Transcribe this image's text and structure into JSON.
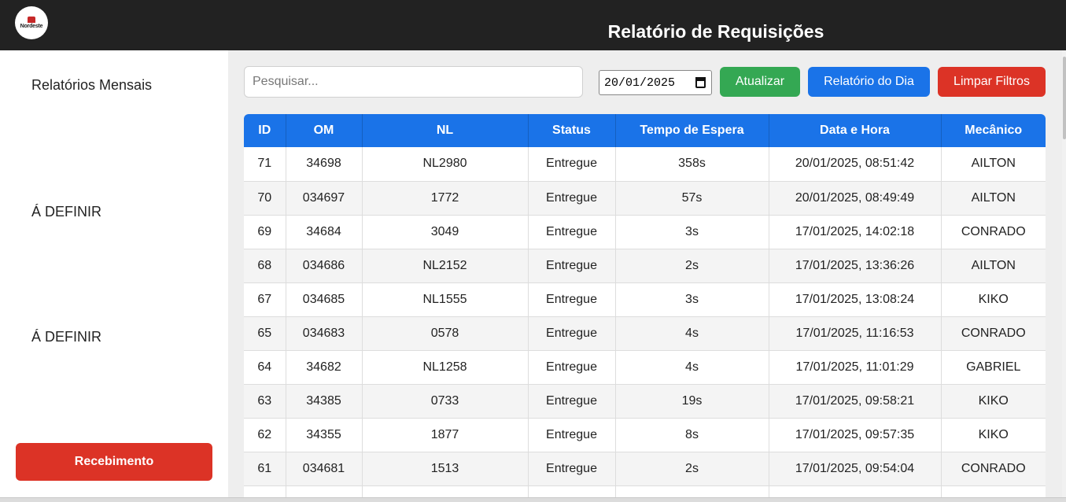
{
  "header": {
    "logo_text": "Nordeste",
    "title": "Relatório de Requisições"
  },
  "sidebar": {
    "items": [
      {
        "label": "Relatórios Mensais"
      },
      {
        "label": "Á DEFINIR"
      },
      {
        "label": "Á DEFINIR"
      }
    ],
    "action_button": "Recebimento"
  },
  "toolbar": {
    "search_placeholder": "Pesquisar...",
    "search_value": "",
    "date_value": "20/01/2025",
    "refresh_label": "Atualizar",
    "day_report_label": "Relatório do Dia",
    "clear_filters_label": "Limpar Filtros"
  },
  "colors": {
    "header_bg": "#222222",
    "table_header": "#1a73e8",
    "green": "#34a853",
    "blue": "#1a73e8",
    "red": "#dc3326"
  },
  "table": {
    "columns": [
      "ID",
      "OM",
      "NL",
      "Status",
      "Tempo de Espera",
      "Data e Hora",
      "Mecânico"
    ],
    "rows": [
      [
        "71",
        "34698",
        "NL2980",
        "Entregue",
        "358s",
        "20/01/2025, 08:51:42",
        "AILTON"
      ],
      [
        "70",
        "034697",
        "1772",
        "Entregue",
        "57s",
        "20/01/2025, 08:49:49",
        "AILTON"
      ],
      [
        "69",
        "34684",
        "3049",
        "Entregue",
        "3s",
        "17/01/2025, 14:02:18",
        "CONRADO"
      ],
      [
        "68",
        "034686",
        "NL2152",
        "Entregue",
        "2s",
        "17/01/2025, 13:36:26",
        "AILTON"
      ],
      [
        "67",
        "034685",
        "NL1555",
        "Entregue",
        "3s",
        "17/01/2025, 13:08:24",
        "KIKO"
      ],
      [
        "65",
        "034683",
        "0578",
        "Entregue",
        "4s",
        "17/01/2025, 11:16:53",
        "CONRADO"
      ],
      [
        "64",
        "34682",
        "NL1258",
        "Entregue",
        "4s",
        "17/01/2025, 11:01:29",
        "GABRIEL"
      ],
      [
        "63",
        "34385",
        "0733",
        "Entregue",
        "19s",
        "17/01/2025, 09:58:21",
        "KIKO"
      ],
      [
        "62",
        "34355",
        "1877",
        "Entregue",
        "8s",
        "17/01/2025, 09:57:35",
        "KIKO"
      ],
      [
        "61",
        "034681",
        "1513",
        "Entregue",
        "2s",
        "17/01/2025, 09:54:04",
        "CONRADO"
      ],
      [
        "",
        "",
        "",
        "",
        "",
        "",
        ""
      ]
    ]
  }
}
